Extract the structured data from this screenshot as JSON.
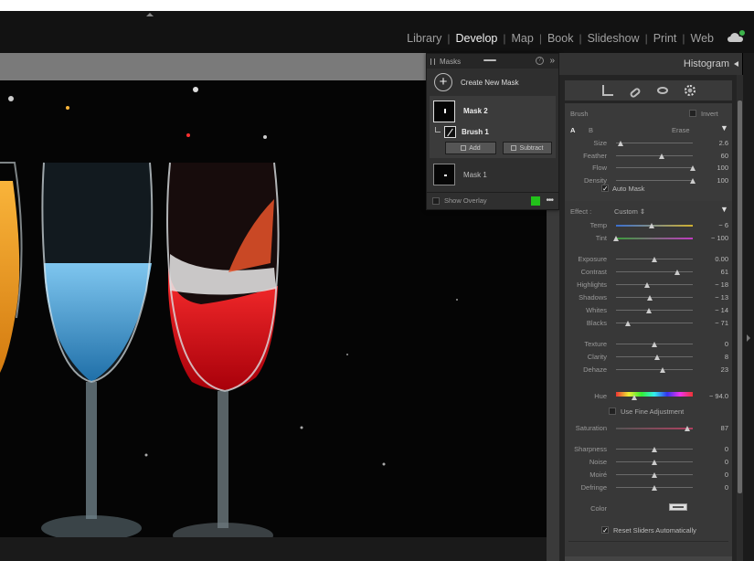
{
  "topbar": {
    "modules": [
      "Library",
      "Develop",
      "Map",
      "Book",
      "Slideshow",
      "Print",
      "Web"
    ],
    "active_module": "Develop",
    "cloud_icon": "cloud-sync-icon",
    "cloud_status_color": "#3cb34a"
  },
  "masks_panel": {
    "title": "Masks",
    "create_label": "Create New Mask",
    "mask2_label": "Mask 2",
    "brush1_label": "Brush 1",
    "add_label": "Add",
    "subtract_label": "Subtract",
    "mask1_label": "Mask 1",
    "show_overlay_label": "Show Overlay",
    "overlay_color": "#22c21a"
  },
  "right_panel": {
    "histogram_label": "Histogram",
    "brush": {
      "title": "Brush",
      "invert_label": "Invert",
      "a_label": "A",
      "b_label": "B",
      "erase_label": "Erase",
      "auto_mask_label": "Auto Mask",
      "sliders": [
        {
          "label": "Size",
          "value": "2.6",
          "pos": 0.06
        },
        {
          "label": "Feather",
          "value": "60",
          "pos": 0.6
        },
        {
          "label": "Flow",
          "value": "100",
          "pos": 1.0
        },
        {
          "label": "Density",
          "value": "100",
          "pos": 1.0
        }
      ]
    },
    "effect": {
      "label": "Effect :",
      "preset": "Custom ⇕",
      "sliders_a": [
        {
          "label": "Temp",
          "value": "− 6",
          "pos": 0.47
        },
        {
          "label": "Tint",
          "value": "− 100",
          "pos": 0.0
        }
      ],
      "sliders_b": [
        {
          "label": "Exposure",
          "value": "0.00",
          "pos": 0.5
        },
        {
          "label": "Contrast",
          "value": "61",
          "pos": 0.8
        },
        {
          "label": "Highlights",
          "value": "− 18",
          "pos": 0.41
        },
        {
          "label": "Shadows",
          "value": "− 13",
          "pos": 0.44
        },
        {
          "label": "Whites",
          "value": "− 14",
          "pos": 0.43
        },
        {
          "label": "Blacks",
          "value": "− 71",
          "pos": 0.15
        }
      ],
      "sliders_c": [
        {
          "label": "Texture",
          "value": "0",
          "pos": 0.5
        },
        {
          "label": "Clarity",
          "value": "8",
          "pos": 0.54
        },
        {
          "label": "Dehaze",
          "value": "23",
          "pos": 0.61
        }
      ],
      "hue_label": "Hue",
      "hue_value": "− 94.0",
      "hue_pos": 0.24,
      "fine_adjust_label": "Use Fine Adjustment",
      "saturation_label": "Saturation",
      "saturation_value": "87",
      "saturation_pos": 0.93,
      "sliders_d": [
        {
          "label": "Sharpness",
          "value": "0",
          "pos": 0.5
        },
        {
          "label": "Noise",
          "value": "0",
          "pos": 0.5
        },
        {
          "label": "Moiré",
          "value": "0",
          "pos": 0.5
        },
        {
          "label": "Defringe",
          "value": "0",
          "pos": 0.5
        }
      ],
      "color_label": "Color",
      "reset_label": "Reset Sliders Automatically"
    }
  }
}
